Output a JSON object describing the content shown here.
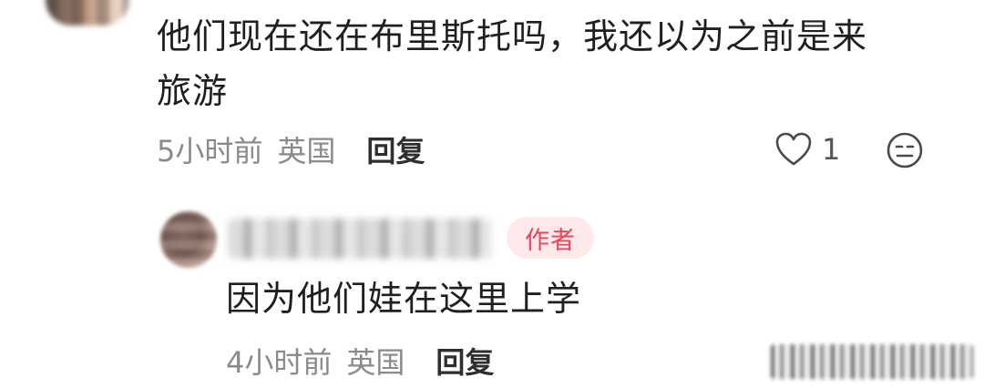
{
  "comments": [
    {
      "text_line1": "他们现在还在布里斯托吗，我还以为之前是来",
      "text_line2": "旅游",
      "time": "5小时前",
      "region": "英国",
      "reply_label": "回复",
      "like_count": "1",
      "like_icon": "heart-outline-icon",
      "dislike_icon": "neutral-face-icon"
    },
    {
      "badge": "作者",
      "text": "因为他们娃在这里上学",
      "time": "4小时前",
      "region": "英国",
      "reply_label": "回复"
    }
  ],
  "colors": {
    "badge_bg": "#fde8ea",
    "badge_text": "#e6475a",
    "meta_text": "#8a8a8a",
    "body_text": "#1f1f1f"
  }
}
